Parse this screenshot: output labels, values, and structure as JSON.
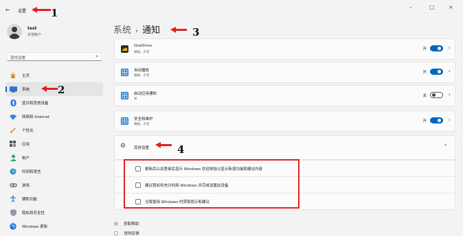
{
  "titlebar": {
    "back_glyph": "←",
    "title": "设置",
    "minimize_glyph": "–",
    "maximize_glyph": "□",
    "close_glyph": "×"
  },
  "user": {
    "name": "test",
    "account": "本地帐户"
  },
  "search": {
    "placeholder": "查找设置",
    "icon": "search-icon"
  },
  "sidebar": {
    "items": [
      {
        "label": "主页",
        "icon": "home-icon",
        "active": false
      },
      {
        "label": "系统",
        "icon": "system-icon",
        "active": true
      },
      {
        "label": "蓝牙和其他设备",
        "icon": "bluetooth-icon",
        "active": false
      },
      {
        "label": "网络和 Internet",
        "icon": "wifi-icon",
        "active": false
      },
      {
        "label": "个性化",
        "icon": "brush-icon",
        "active": false
      },
      {
        "label": "应用",
        "icon": "apps-icon",
        "active": false
      },
      {
        "label": "帐户",
        "icon": "account-icon",
        "active": false
      },
      {
        "label": "时间和语言",
        "icon": "globe-clock-icon",
        "active": false
      },
      {
        "label": "游戏",
        "icon": "gamepad-icon",
        "active": false
      },
      {
        "label": "辅助功能",
        "icon": "accessibility-icon",
        "active": false
      },
      {
        "label": "隐私和安全性",
        "icon": "shield-icon",
        "active": false
      },
      {
        "label": "Windows 更新",
        "icon": "windows-update-icon",
        "active": false
      }
    ]
  },
  "breadcrumb": {
    "parent": "系统",
    "separator": "›",
    "current": "通知"
  },
  "notifications": [
    {
      "title": "OneDrive",
      "subtitle": "横幅，声音",
      "state": "开",
      "on": true,
      "icon": "onedrive-icon"
    },
    {
      "title": "自动播放",
      "subtitle": "横幅，声音",
      "state": "开",
      "on": true,
      "icon": "autoplay-icon"
    },
    {
      "title": "启动应用通知",
      "subtitle": "关",
      "state": "关",
      "on": false,
      "icon": "startup-apps-icon"
    },
    {
      "title": "安全和维护",
      "subtitle": "横幅，声音",
      "state": "开",
      "on": true,
      "icon": "security-maintenance-icon"
    }
  ],
  "other_settings": {
    "label": "其他设置",
    "options": [
      {
        "label": "更新后以及登录后显示 Windows 欢迎体验以显示新增功能和建议内容",
        "checked": false
      },
      {
        "label": "建议我如何充分利用 Windows 并完成设置此设备",
        "checked": false
      },
      {
        "label": "当我使用 Windows 时获取提示和建议",
        "checked": false
      }
    ]
  },
  "links": [
    {
      "label": "获取帮助",
      "icon": "help-icon"
    },
    {
      "label": "提供反馈",
      "icon": "feedback-icon"
    }
  ],
  "annotations": [
    "1",
    "2",
    "3",
    "4"
  ],
  "colors": {
    "accent": "#0067c0",
    "annotation": "#e02020"
  }
}
